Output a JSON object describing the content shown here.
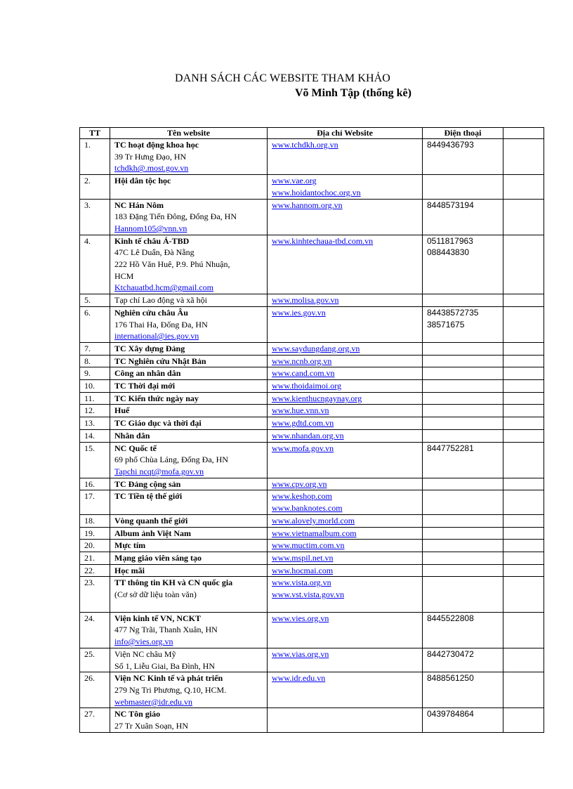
{
  "document": {
    "title": "DANH SÁCH CÁC WEBSITE  THAM KHẢO",
    "subtitle": "Võ Minh Tập (thống kê)"
  },
  "table": {
    "headers": [
      "TT",
      "Tên website",
      "Địa chỉ Website",
      "Điện thoại",
      ""
    ],
    "rows": [
      {
        "tt": "1.",
        "name": "TC hoạt động khoa học",
        "name_bold": true,
        "details": [
          "39 Tr Hưng Đạo, HN"
        ],
        "email": "tchdkh@.most.gov.vn",
        "urls": [
          "www.tchdkh.org.vn"
        ],
        "phones": [
          "8449436793"
        ]
      },
      {
        "tt": "2.",
        "name": "Hội dân tộc học",
        "name_bold": true,
        "details": [],
        "email": "",
        "urls": [
          "www.vae.org",
          "www.hoidantochoc.org.vn"
        ],
        "phones": []
      },
      {
        "tt": "3.",
        "name": "NC Hán Nôm",
        "name_bold": true,
        "details": [
          "183  Đặng Tiến Đông, Đống Đa, HN"
        ],
        "email": "Hannom105@vnn.vn",
        "urls": [
          "www.hannom.org.vn"
        ],
        "phones": [
          "8448573194"
        ]
      },
      {
        "tt": "4.",
        "name": "Kinh tế châu Á-TBD",
        "name_bold": true,
        "details": [
          "47C  Lê Duẩn, Đà Nẵng",
          "222  Hồ Văn Huê, P.9. Phú Nhuận,",
          "HCM"
        ],
        "email": "Ktchauatbd.hcm@gmail.com",
        "urls": [
          "www.kinhtechaua-tbd.com.vn"
        ],
        "phones": [
          "0511817963",
          "088443830"
        ]
      },
      {
        "tt": "5.",
        "name": "Tạp chí Lao động và  xã  hội",
        "name_bold": false,
        "details": [],
        "email": "",
        "urls": [
          "www.molisa.gov.vn"
        ],
        "phones": []
      },
      {
        "tt": "6.",
        "name": "Nghiên cứu châu Âu",
        "name_bold": true,
        "details": [
          "176  Thai Ha, Đống Đa,  HN"
        ],
        "email": "international@ies.gov.vn",
        "urls": [
          "www.ies.gov.vn"
        ],
        "phones": [
          "84438572735",
          "38571675"
        ]
      },
      {
        "tt": "7.",
        "name": "TC  Xây dựng  Đảng",
        "name_bold": true,
        "details": [],
        "email": "",
        "urls": [
          "www.saydungdang.org.vn"
        ],
        "phones": []
      },
      {
        "tt": "8.",
        "name": "TC  Nghiên cứu Nhật Bản",
        "name_bold": true,
        "details": [],
        "email": "",
        "urls": [
          "www.ncnb.org.vn"
        ],
        "phones": []
      },
      {
        "tt": "9.",
        "name": "Công  an nhân  dân",
        "name_bold": true,
        "details": [],
        "email": "",
        "urls": [
          "www.cand.com.vn"
        ],
        "phones": []
      },
      {
        "tt": "10.",
        "name": "TC  Thời đại mới",
        "name_bold": true,
        "details": [],
        "email": "",
        "urls": [
          "www.thoidaimoi.org"
        ],
        "phones": []
      },
      {
        "tt": "11.",
        "name": "TC  Kiến thức ngày nay",
        "name_bold": true,
        "details": [],
        "email": "",
        "urls": [
          "www.kienthucngaynay.org"
        ],
        "phones": []
      },
      {
        "tt": "12.",
        "name": "Huế",
        "name_bold": true,
        "details": [],
        "email": "",
        "urls": [
          "www.hue.vnn.vn"
        ],
        "phones": []
      },
      {
        "tt": "13.",
        "name": "TC  Giáo  dục và  thời đại",
        "name_bold": true,
        "details": [],
        "email": "",
        "urls": [
          "www.gdtd.com.vn"
        ],
        "phones": []
      },
      {
        "tt": "14.",
        "name": "Nhân  dân",
        "name_bold": true,
        "details": [],
        "email": "",
        "urls": [
          "www.nhandan.org.vn"
        ],
        "phones": []
      },
      {
        "tt": "15.",
        "name": "NC  Quốc tế",
        "name_bold": true,
        "details": [
          "69  phố Chùa Láng, Đống Đa, HN"
        ],
        "email": "Tapchi  ncqt@mofa.gov.vn",
        "urls": [
          "www.mofa.gov.vn"
        ],
        "phones": [
          "8447752281"
        ]
      },
      {
        "tt": "16.",
        "name": "TC  Đảng  cộng  sản",
        "name_bold": true,
        "details": [],
        "email": "",
        "urls": [
          "www.cpv.org.vn"
        ],
        "phones": []
      },
      {
        "tt": "17.",
        "name": "TC  Tiền tệ thế giới",
        "name_bold": true,
        "details": [],
        "email": "",
        "urls": [
          "www.keshop.com",
          "www.banknotes.com"
        ],
        "phones": []
      },
      {
        "tt": "18.",
        "name": "Vòng  quanh  thế giới",
        "name_bold": true,
        "details": [],
        "email": "",
        "urls": [
          "www.alovely.morld.com"
        ],
        "phones": []
      },
      {
        "tt": "19.",
        "name": "Album  ảnh Việt Nam",
        "name_bold": true,
        "details": [],
        "email": "",
        "urls": [
          "www.vietnamalbum.com"
        ],
        "phones": []
      },
      {
        "tt": "20.",
        "name": "Mực  tím",
        "name_bold": true,
        "details": [],
        "email": "",
        "urls": [
          "www.muctim.com.vn"
        ],
        "phones": []
      },
      {
        "tt": "21.",
        "name": "Mạng  giáo viên sáng tạo",
        "name_bold": true,
        "details": [],
        "email": "",
        "urls": [
          "www.mspil.net.vn"
        ],
        "phones": []
      },
      {
        "tt": "22.",
        "name": "Học  mãi",
        "name_bold": true,
        "details": [],
        "email": "",
        "urls": [
          "www.hocmai.com"
        ],
        "phones": []
      },
      {
        "tt": "23.",
        "name": "TT  thông  tin KH và  CN quốc  gia",
        "name_bold": true,
        "details": [
          "(Cơ sở dữ liệu toàn văn)"
        ],
        "email": "",
        "urls": [
          "www.vista.org.vn",
          "www.vst.vista.gov.vn"
        ],
        "phones": [],
        "extra_space": true
      },
      {
        "tt": "24.",
        "name": "Viện kinh tế VN, NCKT",
        "name_bold": true,
        "details": [
          "477  Ng Trãi,  Thanh Xuân, HN"
        ],
        "email": "info@vies.org.vn",
        "urls": [
          "www.vies.org.vn"
        ],
        "phones": [
          "8445522808"
        ]
      },
      {
        "tt": "25.",
        "name": "Viện NC  châu Mỹ",
        "name_bold": false,
        "details": [
          "Số 1, Liễu Giai,  Ba Đình,  HN"
        ],
        "email": "",
        "urls": [
          "www.vias.org.vn"
        ],
        "phones": [
          "8442730472"
        ]
      },
      {
        "tt": "26.",
        "name": "Viện NC  Kinh tế và phát  triển",
        "name_bold": true,
        "details": [
          "279  Ng Tri Phương, Q.10,  HCM."
        ],
        "email": "webmaster@idr.edu.vn",
        "urls": [
          "www.idr.edu.vn"
        ],
        "phones": [
          "8488561250"
        ]
      },
      {
        "tt": "27.",
        "name": "NC  Tôn giáo",
        "name_bold": true,
        "details": [
          "27  Tr Xuân Soạn, HN"
        ],
        "email": "",
        "urls": [],
        "phones": [
          "0439784864"
        ]
      }
    ]
  }
}
